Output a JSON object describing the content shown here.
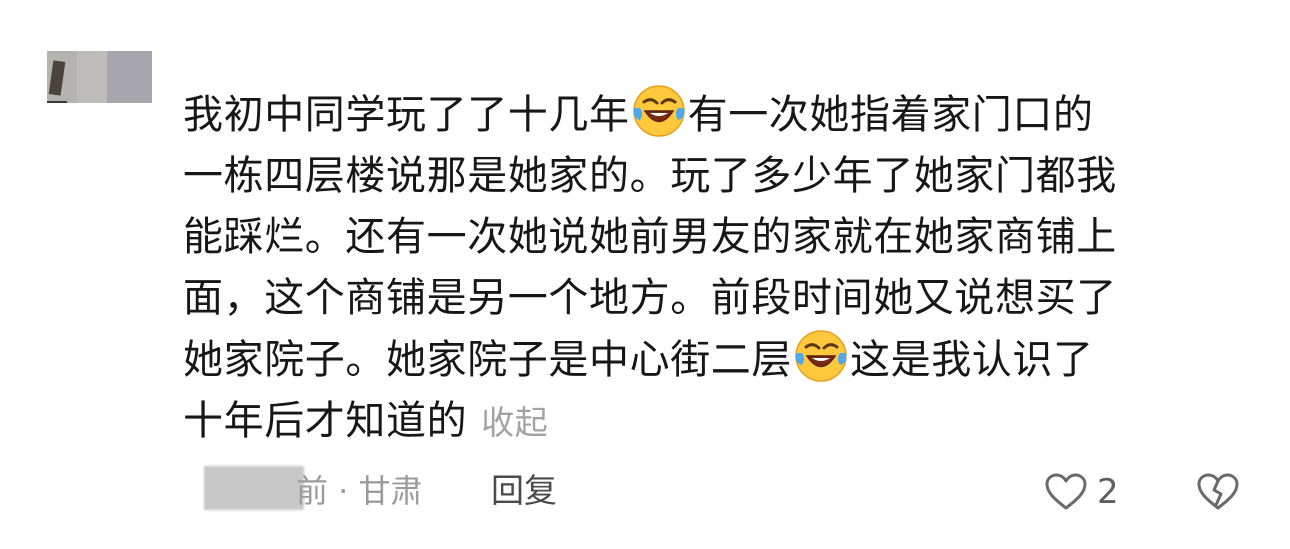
{
  "comment": {
    "segments": [
      [
        "我初中同学玩了了十几年",
        "有一次她指着家门口的"
      ],
      [
        "一栋四层楼说那是她家的。玩了多少年了她家门都我"
      ],
      [
        "能踩烂。还有一次她说她前男友的家就在她家商铺上"
      ],
      [
        "面，这个商铺是另一个地方。前段时间她又说想买了"
      ],
      [
        "她家院子。她家院子是中心街二层",
        "这是我认识了"
      ],
      [
        "十年后才知道的"
      ]
    ],
    "emoji": "face-with-tears-of-joy-icon",
    "collapse_label": "收起"
  },
  "meta": {
    "time_location": "前 · 甘肃",
    "reply_label": "回复"
  },
  "actions": {
    "like_count": "2",
    "like_icon": "heart-outline-icon",
    "dislike_icon": "broken-heart-icon"
  },
  "colors": {
    "text": "#171717",
    "secondary": "#9b9b9b",
    "collapse": "#a2a2a2",
    "icon": "#6a6a6a"
  }
}
